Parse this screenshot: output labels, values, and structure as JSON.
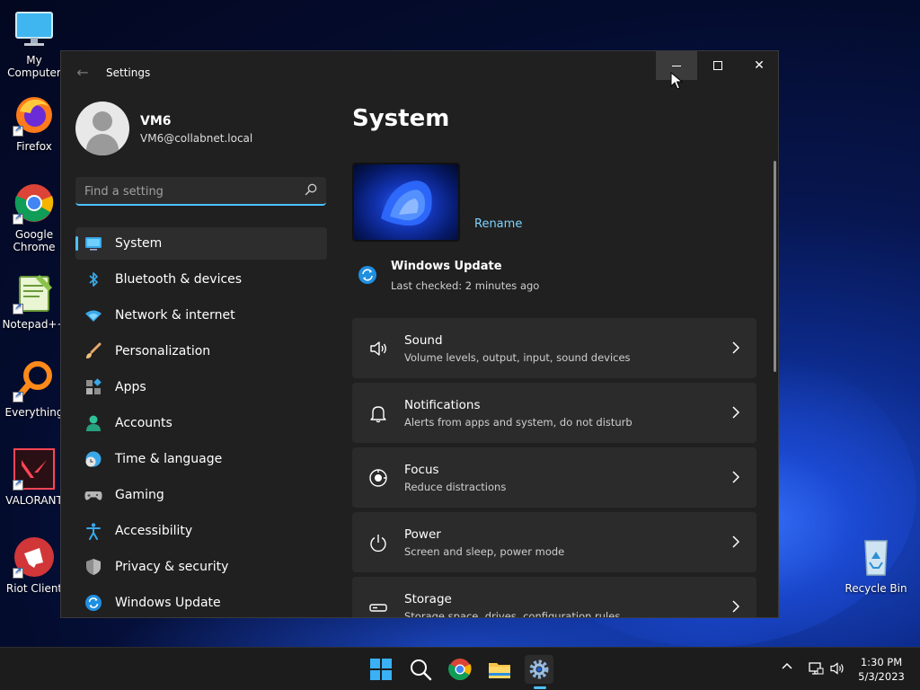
{
  "desktop": {
    "icons": [
      {
        "label": "My Computer"
      },
      {
        "label": "Firefox"
      },
      {
        "label": "Google Chrome"
      },
      {
        "label": "Notepad++"
      },
      {
        "label": "Everything"
      },
      {
        "label": "VALORANT"
      },
      {
        "label": "Riot Client"
      },
      {
        "label": "Recycle Bin"
      }
    ]
  },
  "window": {
    "title": "Settings",
    "profile": {
      "name": "VM6",
      "email": "VM6@collabnet.local"
    },
    "search": {
      "placeholder": "Find a setting",
      "value": ""
    },
    "nav": [
      {
        "label": "System",
        "icon": "system-icon",
        "selected": true
      },
      {
        "label": "Bluetooth & devices",
        "icon": "bluetooth-icon"
      },
      {
        "label": "Network & internet",
        "icon": "wifi-icon"
      },
      {
        "label": "Personalization",
        "icon": "brush-icon"
      },
      {
        "label": "Apps",
        "icon": "apps-icon"
      },
      {
        "label": "Accounts",
        "icon": "account-icon"
      },
      {
        "label": "Time & language",
        "icon": "clock-globe-icon"
      },
      {
        "label": "Gaming",
        "icon": "gamepad-icon"
      },
      {
        "label": "Accessibility",
        "icon": "accessibility-icon"
      },
      {
        "label": "Privacy & security",
        "icon": "shield-icon"
      },
      {
        "label": "Windows Update",
        "icon": "update-icon"
      }
    ],
    "main": {
      "title": "System",
      "rename_label": "Rename",
      "update": {
        "title": "Windows Update",
        "subtitle": "Last checked: 2 minutes ago"
      },
      "cards": [
        {
          "title": "Sound",
          "subtitle": "Volume levels, output, input, sound devices",
          "icon": "speaker-icon"
        },
        {
          "title": "Notifications",
          "subtitle": "Alerts from apps and system, do not disturb",
          "icon": "bell-icon"
        },
        {
          "title": "Focus",
          "subtitle": "Reduce distractions",
          "icon": "focus-icon"
        },
        {
          "title": "Power",
          "subtitle": "Screen and sleep, power mode",
          "icon": "power-icon"
        },
        {
          "title": "Storage",
          "subtitle": "Storage space, drives, configuration rules",
          "icon": "storage-icon"
        }
      ]
    }
  },
  "taskbar": {
    "clock_time": "1:30 PM",
    "clock_date": "5/3/2023"
  },
  "colors": {
    "accent": "#4cc2ff",
    "window_bg": "#202020",
    "card_bg": "#2b2b2b"
  }
}
